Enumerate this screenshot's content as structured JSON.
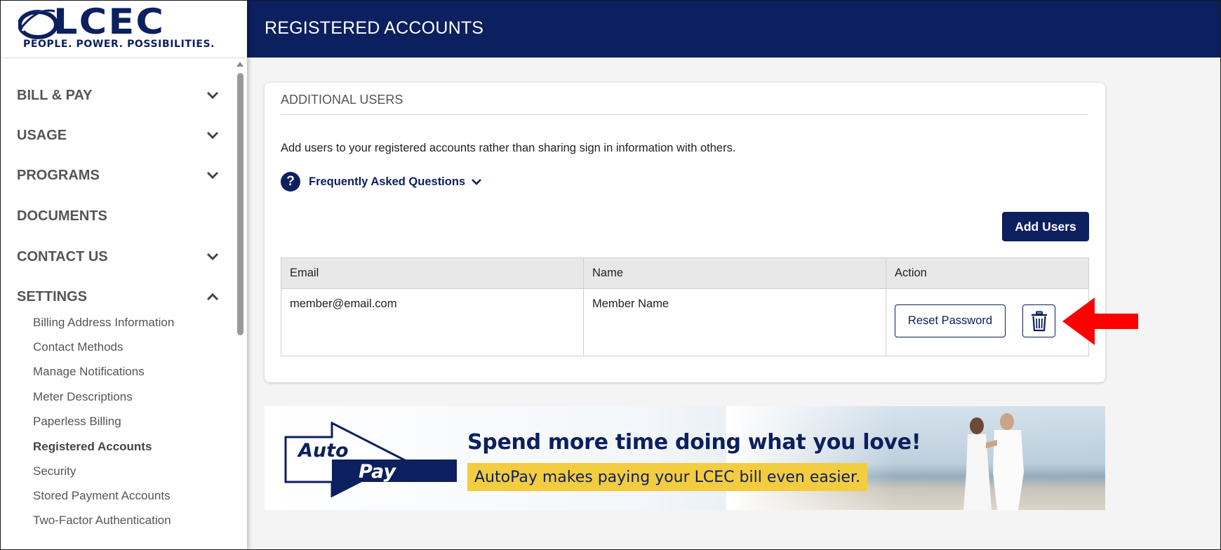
{
  "app": {
    "logo_text": "LCEC",
    "tagline": "PEOPLE. POWER. POSSIBILITIES."
  },
  "header": {
    "title": "REGISTERED ACCOUNTS"
  },
  "sidebar": {
    "items": [
      {
        "label": "BILL & PAY",
        "expandable": true,
        "expanded": false
      },
      {
        "label": "USAGE",
        "expandable": true,
        "expanded": false
      },
      {
        "label": "PROGRAMS",
        "expandable": true,
        "expanded": false
      },
      {
        "label": "DOCUMENTS",
        "expandable": false
      },
      {
        "label": "CONTACT US",
        "expandable": true,
        "expanded": false
      },
      {
        "label": "SETTINGS",
        "expandable": true,
        "expanded": true
      }
    ],
    "settings_subitems": [
      "Billing Address Information",
      "Contact Methods",
      "Manage Notifications",
      "Meter Descriptions",
      "Paperless Billing",
      "Registered Accounts",
      "Security",
      "Stored Payment Accounts",
      "Two-Factor Authentication"
    ],
    "active_subitem": "Registered Accounts"
  },
  "card": {
    "title": "ADDITIONAL USERS",
    "description": "Add users to your registered accounts rather than sharing sign in information with others.",
    "faq_label": "Frequently Asked Questions",
    "faq_icon": "?",
    "add_button": "Add Users",
    "table": {
      "headers": [
        "Email",
        "Name",
        "Action"
      ],
      "rows": [
        {
          "email": "member@email.com",
          "name": "Member Name",
          "reset_label": "Reset Password",
          "delete_icon": "trash-icon"
        }
      ]
    }
  },
  "banner": {
    "logo_word1": "Auto",
    "logo_word2": "Pay",
    "headline": "Spend more time doing what you love!",
    "subline": "AutoPay makes paying your LCEC bill even easier."
  },
  "colors": {
    "brand_navy": "#0c1f5f",
    "highlight_yellow": "#f3cd3f",
    "annotation_red": "#ff0000"
  }
}
